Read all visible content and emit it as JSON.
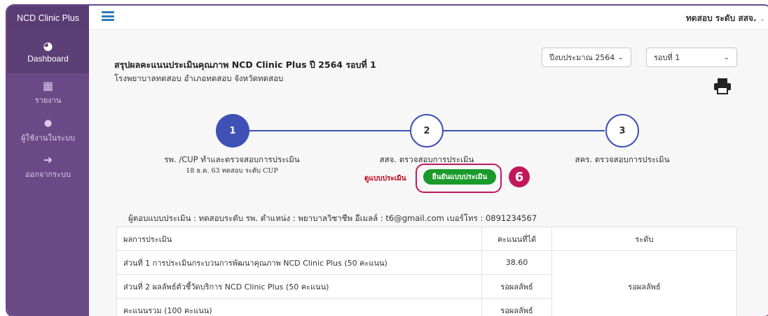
{
  "sidebar": {
    "brand": "NCD Clinic Plus",
    "items": [
      {
        "icon": "pie-chart-icon",
        "glyph": "◕",
        "label": "Dashboard"
      },
      {
        "icon": "table-icon",
        "glyph": "▦",
        "label": "รายงาน"
      },
      {
        "icon": "user-icon",
        "glyph": "●",
        "label": "ผู้ใช้งานในระบบ"
      },
      {
        "icon": "logout-icon",
        "glyph": "➜",
        "label": "ออกจากระบบ"
      }
    ]
  },
  "header": {
    "user_label": "ทดสอบ ระดับ สสจ."
  },
  "report": {
    "title": "สรุปผลคะแนนประเมินคุณภาพ NCD Clinic Plus ปี 2564 รอบที่ 1",
    "subtitle": "โรงพยาบาลทดสอบ อำเภอทดสอบ จังหวัดทดสอบ",
    "fiscal_year_select": "ปีงบประมาณ 2564",
    "round_select": "รอบที่ 1"
  },
  "stepper": {
    "steps": [
      {
        "number": "1",
        "label": "รพ. /CUP ทำและตรวจสอบการประเมิน",
        "meta": "18 ธ.ค. 63 ทดสอบ ระดับ CUP",
        "state": "active"
      },
      {
        "number": "2",
        "label": "สสจ. ตรวจสอบการประเมิน",
        "meta": "",
        "state": "inactive"
      },
      {
        "number": "3",
        "label": "สคร. ตรวจสอบการประเมิน",
        "meta": "",
        "state": "inactive"
      }
    ],
    "view_form_link": "ดูแบบประเมิน",
    "confirm_button": "ยืนยันแบบประเมิน",
    "annotation_number": "6"
  },
  "respondent_line": "ผู้ตอบแบบประเมิน : ทดสอบระดับ รพ. ตำแหน่ง : พยาบาลวิชาชีพ อีเมลล์ : t6@gmail.com เบอร์โทร : 0891234567",
  "table": {
    "headers": [
      "ผลการประเมิน",
      "คะแนนที่ได้",
      "ระดับ"
    ],
    "rows": [
      {
        "item": "ส่วนที่ 1 การประเมินกระบวนการพัฒนาคุณภาพ NCD Clinic Plus (50 คะแนน)",
        "score": "38.60"
      },
      {
        "item": "ส่วนที่ 2 ผลลัพธ์ตัวชี้วัดบริการ NCD Clinic Plus (50 คะแนน)",
        "score": "รอผลลัพธ์"
      },
      {
        "item": "คะแนนรวม (100 คะแนน)",
        "score": "รอผลลัพธ์"
      }
    ],
    "level": "รอผลลัพธ์"
  }
}
